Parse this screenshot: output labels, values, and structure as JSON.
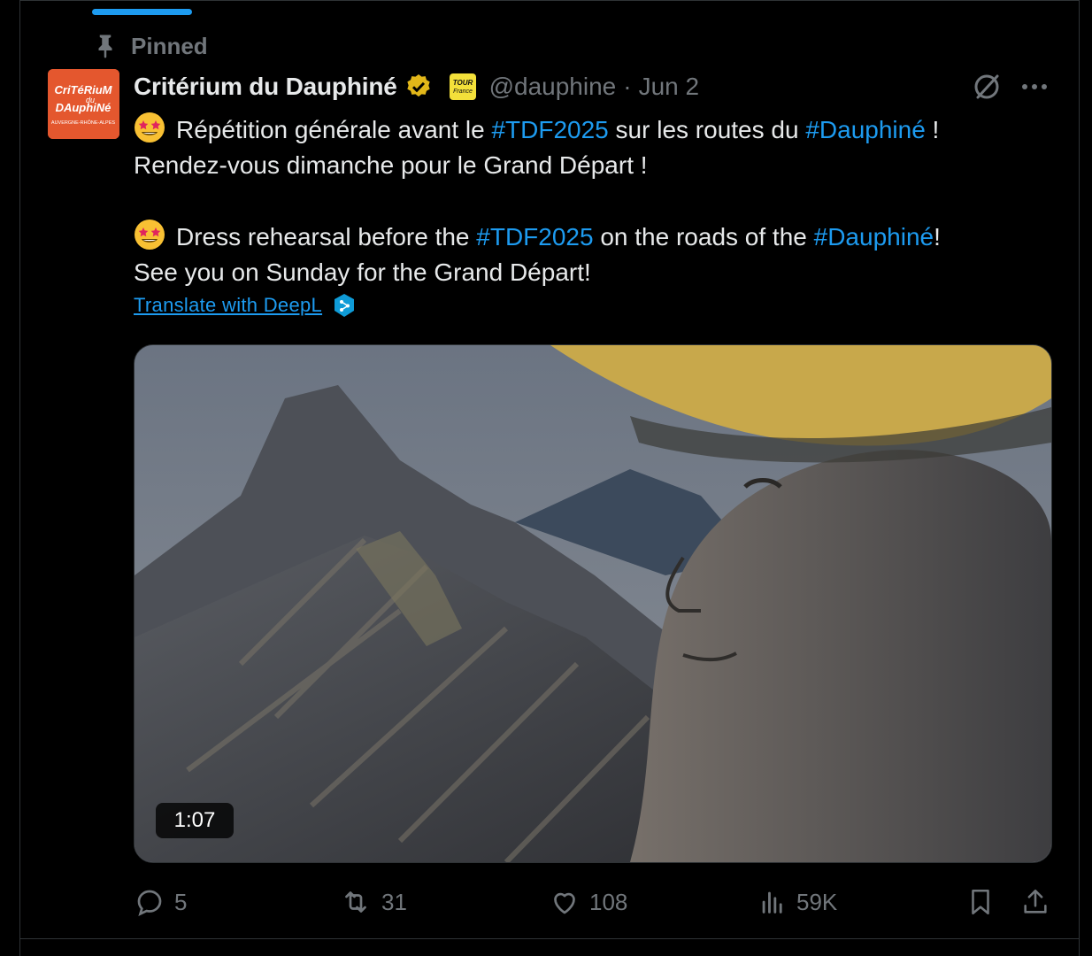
{
  "pinned_label": "Pinned",
  "author": {
    "display_name": "Critérium du Dauphiné",
    "handle": "@dauphine",
    "separator": "·",
    "date": "Jun 2",
    "avatar_lines": [
      "CriTéRiuM",
      "du",
      "DAuphiNé",
      "AUVERGNE-RHÔNE-ALPES"
    ]
  },
  "tweet": {
    "fr_line1_a": "Répétition générale avant le ",
    "fr_tag1": "#TDF2025",
    "fr_line1_b": " sur les routes du ",
    "fr_tag2": "#Dauphiné",
    "fr_line1_c": " !",
    "fr_line2": "Rendez-vous dimanche pour le Grand Départ !",
    "en_line1_a": "Dress rehearsal before the ",
    "en_tag1": "#TDF2025",
    "en_line1_b": " on the roads of the ",
    "en_tag2": "#Dauphiné",
    "en_line1_c": "!",
    "en_line2": "See you on Sunday for the Grand Départ!"
  },
  "translate_label": "Translate with DeepL",
  "video": {
    "duration": "1:07"
  },
  "actions": {
    "replies": "5",
    "reposts": "31",
    "likes": "108",
    "views": "59K"
  },
  "colors": {
    "accent": "#1d9bf0",
    "muted": "#71767b",
    "text": "#e7e9ea",
    "background": "#000000",
    "avatar_bg": "#e4572e",
    "verified_badge": "#e2b719"
  },
  "icons": [
    "pin-icon",
    "verified-badge-icon",
    "tour-de-france-affiliate-icon",
    "grok-icon",
    "more-icon",
    "star-struck-emoji",
    "deepl-icon",
    "reply-icon",
    "repost-icon",
    "like-icon",
    "views-icon",
    "bookmark-icon",
    "share-icon"
  ]
}
